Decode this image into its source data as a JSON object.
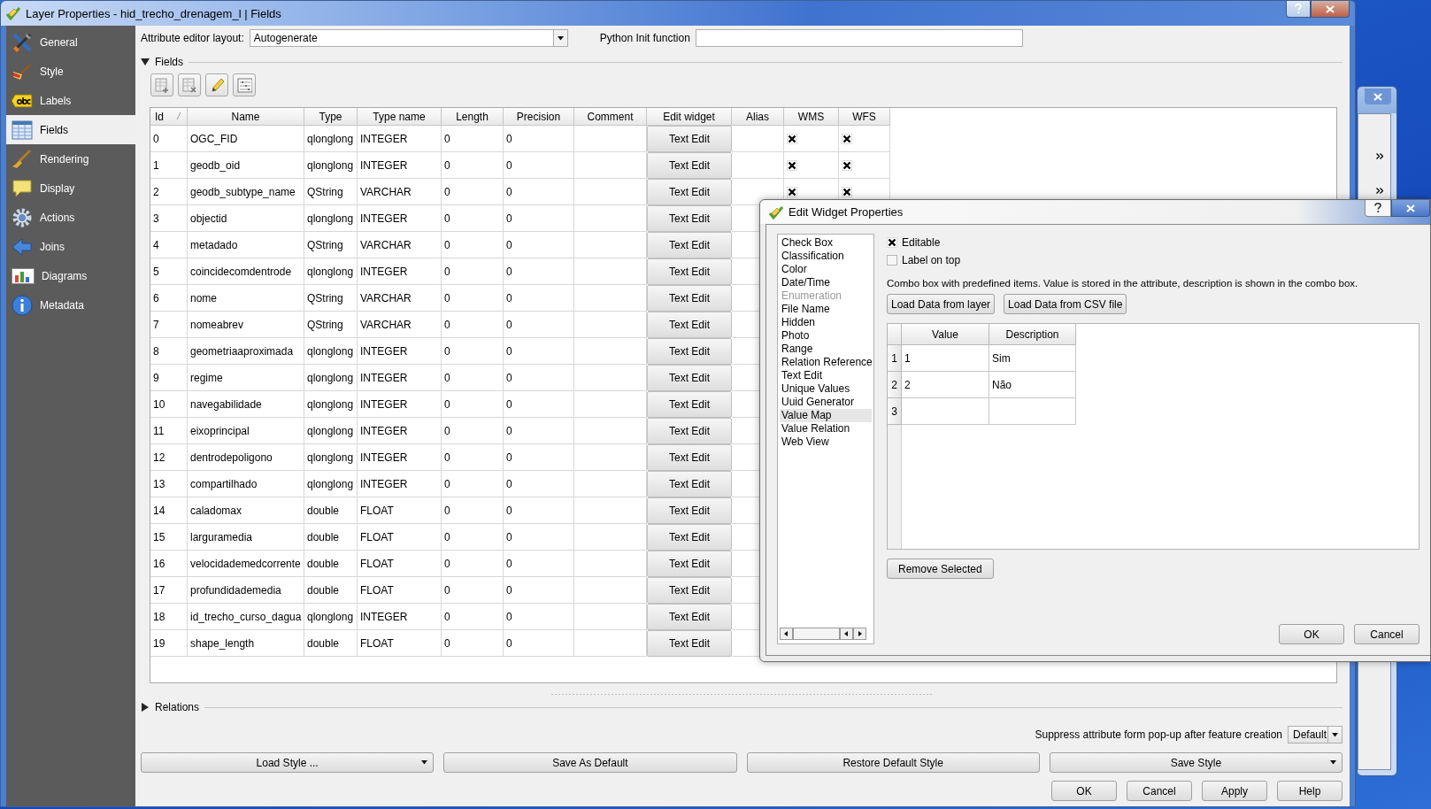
{
  "window": {
    "title": "Layer Properties - hid_trecho_drenagem_l | Fields"
  },
  "sidebar": {
    "items": [
      {
        "label": "General",
        "selected": false
      },
      {
        "label": "Style",
        "selected": false
      },
      {
        "label": "Labels",
        "selected": false
      },
      {
        "label": "Fields",
        "selected": true
      },
      {
        "label": "Rendering",
        "selected": false
      },
      {
        "label": "Display",
        "selected": false
      },
      {
        "label": "Actions",
        "selected": false
      },
      {
        "label": "Joins",
        "selected": false
      },
      {
        "label": "Diagrams",
        "selected": false
      },
      {
        "label": "Metadata",
        "selected": false
      }
    ]
  },
  "editor_layout": {
    "label": "Attribute editor layout:",
    "value": "Autogenerate"
  },
  "python_init": {
    "label": "Python Init function"
  },
  "fields_group": {
    "title": "Fields",
    "expanded": true
  },
  "table": {
    "columns": [
      {
        "label": "Id",
        "sorted": true
      },
      {
        "label": "Name",
        "sorted": false
      },
      {
        "label": "Type",
        "sorted": false
      },
      {
        "label": "Type name",
        "sorted": false
      },
      {
        "label": "Length",
        "sorted": false
      },
      {
        "label": "Precision",
        "sorted": false
      },
      {
        "label": "Comment",
        "sorted": false
      },
      {
        "label": "Edit widget",
        "sorted": false
      },
      {
        "label": "Alias",
        "sorted": false
      },
      {
        "label": "WMS",
        "sorted": false
      },
      {
        "label": "WFS",
        "sorted": false
      }
    ],
    "rows": [
      {
        "id": "0",
        "name": "OGC_FID",
        "type": "qlonglong",
        "type_name": "INTEGER",
        "length": "0",
        "precision": "0",
        "edit_widget": "Text Edit",
        "wms": true,
        "wfs": true
      },
      {
        "id": "1",
        "name": "geodb_oid",
        "type": "qlonglong",
        "type_name": "INTEGER",
        "length": "0",
        "precision": "0",
        "edit_widget": "Text Edit",
        "wms": true,
        "wfs": true
      },
      {
        "id": "2",
        "name": "geodb_subtype_name",
        "type": "QString",
        "type_name": "VARCHAR",
        "length": "0",
        "precision": "0",
        "edit_widget": "Text Edit",
        "wms": true,
        "wfs": true
      },
      {
        "id": "3",
        "name": "objectid",
        "type": "qlonglong",
        "type_name": "INTEGER",
        "length": "0",
        "precision": "0",
        "edit_widget": "Text Edit"
      },
      {
        "id": "4",
        "name": "metadado",
        "type": "QString",
        "type_name": "VARCHAR",
        "length": "0",
        "precision": "0",
        "edit_widget": "Text Edit"
      },
      {
        "id": "5",
        "name": "coincidecomdentrode",
        "type": "qlonglong",
        "type_name": "INTEGER",
        "length": "0",
        "precision": "0",
        "edit_widget": "Text Edit"
      },
      {
        "id": "6",
        "name": "nome",
        "type": "QString",
        "type_name": "VARCHAR",
        "length": "0",
        "precision": "0",
        "edit_widget": "Text Edit"
      },
      {
        "id": "7",
        "name": "nomeabrev",
        "type": "QString",
        "type_name": "VARCHAR",
        "length": "0",
        "precision": "0",
        "edit_widget": "Text Edit"
      },
      {
        "id": "8",
        "name": "geometriaaproximada",
        "type": "qlonglong",
        "type_name": "INTEGER",
        "length": "0",
        "precision": "0",
        "edit_widget": "Text Edit"
      },
      {
        "id": "9",
        "name": "regime",
        "type": "qlonglong",
        "type_name": "INTEGER",
        "length": "0",
        "precision": "0",
        "edit_widget": "Text Edit"
      },
      {
        "id": "10",
        "name": "navegabilidade",
        "type": "qlonglong",
        "type_name": "INTEGER",
        "length": "0",
        "precision": "0",
        "edit_widget": "Text Edit"
      },
      {
        "id": "11",
        "name": "eixoprincipal",
        "type": "qlonglong",
        "type_name": "INTEGER",
        "length": "0",
        "precision": "0",
        "edit_widget": "Text Edit"
      },
      {
        "id": "12",
        "name": "dentrodepoligono",
        "type": "qlonglong",
        "type_name": "INTEGER",
        "length": "0",
        "precision": "0",
        "edit_widget": "Text Edit"
      },
      {
        "id": "13",
        "name": "compartilhado",
        "type": "qlonglong",
        "type_name": "INTEGER",
        "length": "0",
        "precision": "0",
        "edit_widget": "Text Edit"
      },
      {
        "id": "14",
        "name": "caladomax",
        "type": "double",
        "type_name": "FLOAT",
        "length": "0",
        "precision": "0",
        "edit_widget": "Text Edit"
      },
      {
        "id": "15",
        "name": "larguramedia",
        "type": "double",
        "type_name": "FLOAT",
        "length": "0",
        "precision": "0",
        "edit_widget": "Text Edit"
      },
      {
        "id": "16",
        "name": "velocidademedcorrente",
        "type": "double",
        "type_name": "FLOAT",
        "length": "0",
        "precision": "0",
        "edit_widget": "Text Edit"
      },
      {
        "id": "17",
        "name": "profundidademedia",
        "type": "double",
        "type_name": "FLOAT",
        "length": "0",
        "precision": "0",
        "edit_widget": "Text Edit"
      },
      {
        "id": "18",
        "name": "id_trecho_curso_dagua",
        "type": "qlonglong",
        "type_name": "INTEGER",
        "length": "0",
        "precision": "0",
        "edit_widget": "Text Edit"
      },
      {
        "id": "19",
        "name": "shape_length",
        "type": "double",
        "type_name": "FLOAT",
        "length": "0",
        "precision": "0",
        "edit_widget": "Text Edit"
      }
    ]
  },
  "relations_group": {
    "title": "Relations",
    "expanded": false
  },
  "suppress": {
    "label": "Suppress attribute form pop-up after feature creation",
    "value": "Default"
  },
  "style_buttons": [
    {
      "label": "Load Style ...",
      "dropdown": true
    },
    {
      "label": "Save As Default",
      "dropdown": false
    },
    {
      "label": "Restore Default Style",
      "dropdown": false
    },
    {
      "label": "Save Style",
      "dropdown": true
    }
  ],
  "buttons": [
    "OK",
    "Cancel",
    "Apply",
    "Help"
  ],
  "dialog": {
    "title": "Edit Widget Properties",
    "widgets": [
      {
        "label": "Check Box",
        "selected": false,
        "disabled": false
      },
      {
        "label": "Classification",
        "selected": false,
        "disabled": false
      },
      {
        "label": "Color",
        "selected": false,
        "disabled": false
      },
      {
        "label": "Date/Time",
        "selected": false,
        "disabled": false
      },
      {
        "label": "Enumeration",
        "selected": false,
        "disabled": true
      },
      {
        "label": "File Name",
        "selected": false,
        "disabled": false
      },
      {
        "label": "Hidden",
        "selected": false,
        "disabled": false
      },
      {
        "label": "Photo",
        "selected": false,
        "disabled": false
      },
      {
        "label": "Range",
        "selected": false,
        "disabled": false
      },
      {
        "label": "Relation Reference",
        "selected": false,
        "disabled": false
      },
      {
        "label": "Text Edit",
        "selected": false,
        "disabled": false
      },
      {
        "label": "Unique Values",
        "selected": false,
        "disabled": false
      },
      {
        "label": "Uuid Generator",
        "selected": false,
        "disabled": false
      },
      {
        "label": "Value Map",
        "selected": true,
        "disabled": false
      },
      {
        "label": "Value Relation",
        "selected": false,
        "disabled": false
      },
      {
        "label": "Web View",
        "selected": false,
        "disabled": false
      }
    ],
    "editable": {
      "label": "Editable",
      "checked": true
    },
    "label_on_top": {
      "label": "Label on top",
      "checked": false
    },
    "description": "Combo box with predefined items. Value is stored in the attribute, description is shown in the combo box.",
    "load_buttons": [
      "Load Data from layer",
      "Load Data from CSV file"
    ],
    "map": {
      "columns": [
        "Value",
        "Description"
      ],
      "rows": [
        {
          "number": "1",
          "value": "1",
          "description": "Sim"
        },
        {
          "number": "2",
          "value": "2",
          "description": "Não"
        },
        {
          "number": "3"
        }
      ]
    },
    "remove_button": "Remove Selected",
    "buttons": [
      "OK",
      "Cancel"
    ]
  }
}
